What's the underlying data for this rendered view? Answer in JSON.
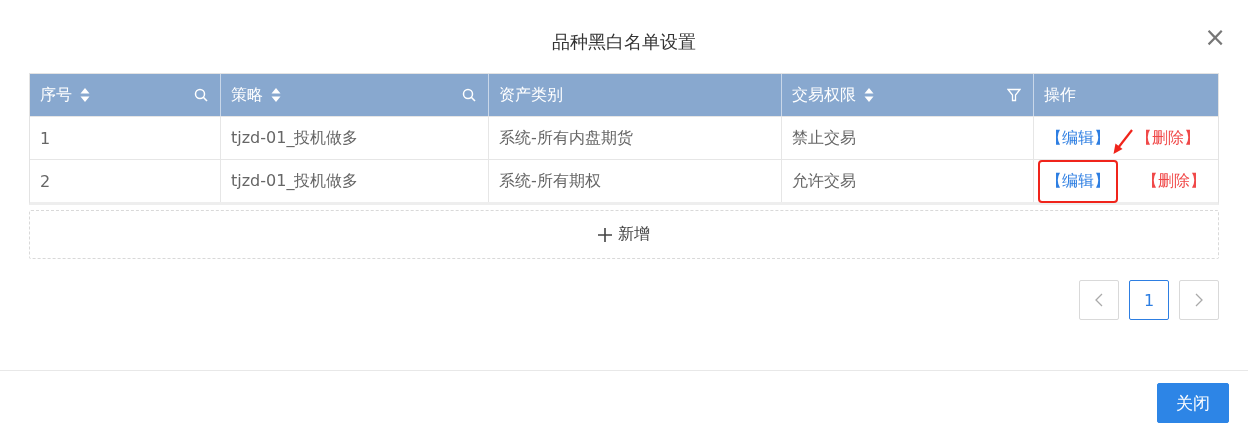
{
  "dialog": {
    "title": "品种黑白名单设置",
    "close_icon": "×"
  },
  "table": {
    "columns": [
      {
        "label": "序号",
        "sortable": true,
        "searchable": true,
        "filterable": false
      },
      {
        "label": "策略",
        "sortable": true,
        "searchable": true,
        "filterable": false
      },
      {
        "label": "资产类别",
        "sortable": false,
        "searchable": false,
        "filterable": false
      },
      {
        "label": "交易权限",
        "sortable": true,
        "searchable": false,
        "filterable": true
      },
      {
        "label": "操作",
        "sortable": false,
        "searchable": false,
        "filterable": false
      }
    ],
    "rows": [
      {
        "cells": [
          "1",
          "tjzd-01_投机做多",
          "系统-所有内盘期货",
          "禁止交易"
        ],
        "actions": [
          {
            "kind": "edit",
            "label": "【编辑】",
            "highlighted": false
          },
          {
            "kind": "delete",
            "label": "【删除】",
            "highlighted": false
          }
        ],
        "pointer_arrow": true
      },
      {
        "cells": [
          "2",
          "tjzd-01_投机做多",
          "系统-所有期权",
          "允许交易"
        ],
        "actions": [
          {
            "kind": "edit",
            "label": "【编辑】",
            "highlighted": true
          },
          {
            "kind": "delete",
            "label": "【删除】",
            "highlighted": false
          }
        ],
        "pointer_arrow": false
      }
    ]
  },
  "add_button": {
    "label": "新增"
  },
  "pagination": {
    "pages": [
      {
        "label": "1",
        "selected": true
      }
    ]
  },
  "footer": {
    "buttons": [
      {
        "label": "关闭",
        "kind": "primary"
      }
    ]
  }
}
